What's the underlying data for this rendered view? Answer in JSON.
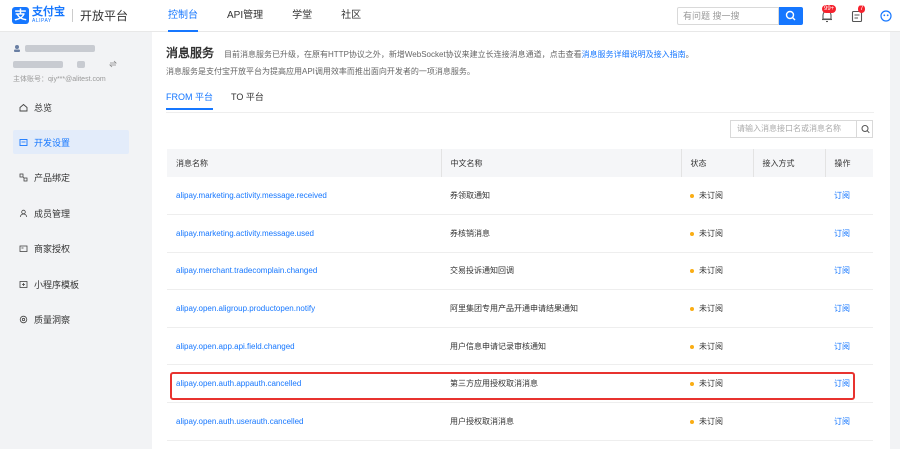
{
  "brand": {
    "cn": "支付宝",
    "en": "ALIPAY",
    "platform": "开放平台"
  },
  "topnav": [
    "控制台",
    "API管理",
    "学堂",
    "社区"
  ],
  "search": {
    "placeholder": "有问题 搜一搜"
  },
  "notifications": {
    "bell_badge": "99+",
    "task_badge": "7"
  },
  "sidebar": {
    "account_main": "主体账号：qiy***@alitest.com",
    "items": [
      {
        "label": "总览",
        "icon": "home-icon"
      },
      {
        "label": "开发设置",
        "icon": "settings-icon"
      },
      {
        "label": "产品绑定",
        "icon": "product-icon"
      },
      {
        "label": "成员管理",
        "icon": "members-icon"
      },
      {
        "label": "商家授权",
        "icon": "merchant-icon"
      },
      {
        "label": "小程序模板",
        "icon": "template-icon"
      },
      {
        "label": "质量洞察",
        "icon": "quality-icon"
      }
    ]
  },
  "page": {
    "title": "消息服务",
    "desc_pre": "目前消息服务已升级，在原有HTTP协议之外，新增WebSocket协议来建立长连接消息通道，点击查看",
    "desc_link": "消息服务详细说明及接入指南",
    "desc_post": "。",
    "subdesc": "消息服务是支付宝开放平台为提高应用API调用效率而推出面向开发者的一项消息服务。",
    "tabs": [
      "FROM 平台",
      "TO 平台"
    ],
    "filter_placeholder": "请输入消息接口名或消息名称"
  },
  "table": {
    "headers": [
      "消息名称",
      "中文名称",
      "状态",
      "接入方式",
      "操作"
    ],
    "rows": [
      {
        "name": "alipay.marketing.activity.message.received",
        "cn": "券领取通知",
        "status": "未订阅",
        "mode": "",
        "op": "订阅"
      },
      {
        "name": "alipay.marketing.activity.message.used",
        "cn": "券核销消息",
        "status": "未订阅",
        "mode": "",
        "op": "订阅"
      },
      {
        "name": "alipay.merchant.tradecomplain.changed",
        "cn": "交易投诉通知回调",
        "status": "未订阅",
        "mode": "",
        "op": "订阅"
      },
      {
        "name": "alipay.open.aligroup.productopen.notify",
        "cn": "阿里集团专用产品开通申请结果通知",
        "status": "未订阅",
        "mode": "",
        "op": "订阅"
      },
      {
        "name": "alipay.open.app.api.field.changed",
        "cn": "用户信息申请记录审核通知",
        "status": "未订阅",
        "mode": "",
        "op": "订阅"
      },
      {
        "name": "alipay.open.auth.appauth.cancelled",
        "cn": "第三方应用授权取消消息",
        "status": "未订阅",
        "mode": "",
        "op": "订阅"
      },
      {
        "name": "alipay.open.auth.userauth.cancelled",
        "cn": "用户授权取消消息",
        "status": "未订阅",
        "mode": "",
        "op": "订阅"
      }
    ]
  },
  "colors": {
    "accent": "#1677ff",
    "highlight": "#e8332f",
    "status_dot": "#faad14"
  }
}
